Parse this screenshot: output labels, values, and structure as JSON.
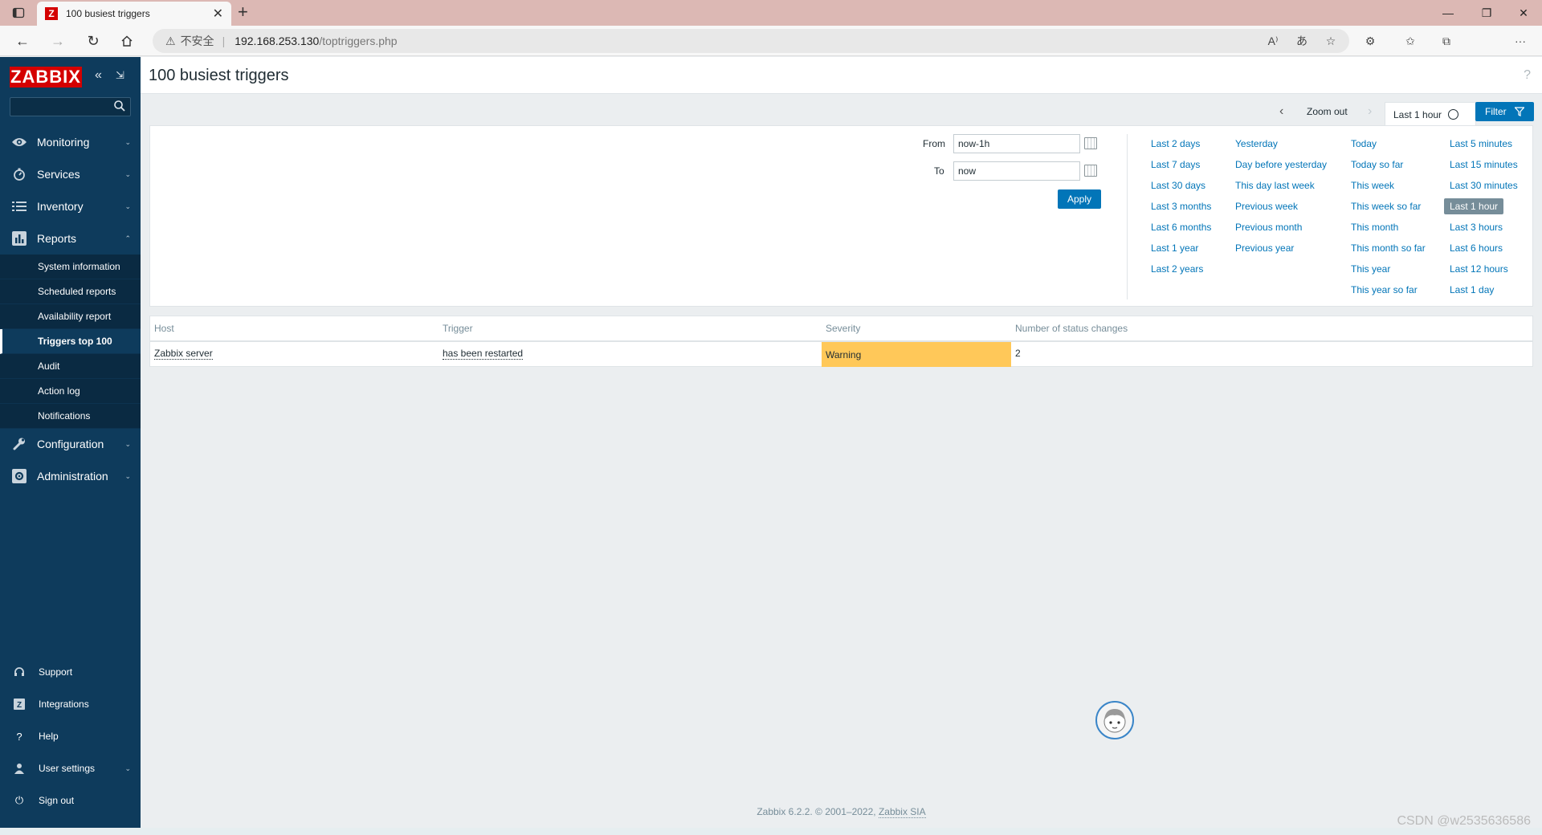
{
  "browser": {
    "tab_title": "100 busiest triggers",
    "favicon_letter": "Z",
    "url_security": "不安全",
    "url_host": "192.168.253.130",
    "url_path": "/toptriggers.php"
  },
  "sidebar": {
    "logo": "ZABBIX",
    "menu": [
      {
        "label": "Monitoring",
        "icon": "eye-icon"
      },
      {
        "label": "Services",
        "icon": "services-icon"
      },
      {
        "label": "Inventory",
        "icon": "list-icon"
      },
      {
        "label": "Reports",
        "icon": "reports-icon"
      },
      {
        "label": "Configuration",
        "icon": "wrench-icon"
      },
      {
        "label": "Administration",
        "icon": "gear-icon"
      }
    ],
    "reports_sub": [
      "System information",
      "Scheduled reports",
      "Availability report",
      "Triggers top 100",
      "Audit",
      "Action log",
      "Notifications"
    ],
    "bottom": [
      {
        "label": "Support",
        "icon": "headset-icon"
      },
      {
        "label": "Integrations",
        "icon": "integrations-icon"
      },
      {
        "label": "Help",
        "icon": "question-icon"
      },
      {
        "label": "User settings",
        "icon": "user-icon"
      },
      {
        "label": "Sign out",
        "icon": "power-icon"
      }
    ]
  },
  "page": {
    "title": "100 busiest triggers",
    "help_glyph": "?"
  },
  "timebar": {
    "zoom_out": "Zoom out",
    "period": "Last 1 hour",
    "filter": "Filter"
  },
  "filter": {
    "from_label": "From",
    "from_value": "now-1h",
    "to_label": "To",
    "to_value": "now",
    "apply": "Apply",
    "quick_ranges": [
      [
        "Last 2 days",
        "Last 7 days",
        "Last 30 days",
        "Last 3 months",
        "Last 6 months",
        "Last 1 year",
        "Last 2 years"
      ],
      [
        "Yesterday",
        "Day before yesterday",
        "This day last week",
        "Previous week",
        "Previous month",
        "Previous year"
      ],
      [
        "Today",
        "Today so far",
        "This week",
        "This week so far",
        "This month",
        "This month so far",
        "This year",
        "This year so far"
      ],
      [
        "Last 5 minutes",
        "Last 15 minutes",
        "Last 30 minutes",
        "Last 1 hour",
        "Last 3 hours",
        "Last 6 hours",
        "Last 12 hours",
        "Last 1 day"
      ]
    ],
    "selected_range": "Last 1 hour"
  },
  "table": {
    "columns": [
      "Host",
      "Trigger",
      "Severity",
      "Number of status changes"
    ],
    "rows": [
      {
        "host": "Zabbix server",
        "trigger": "has been restarted",
        "severity": "Warning",
        "changes": "2"
      }
    ],
    "severity_color": "#ffc859"
  },
  "footer": {
    "text": "Zabbix 6.2.2. © 2001–2022, ",
    "company": "Zabbix SIA"
  },
  "watermark": "CSDN @w2535636586",
  "colors": {
    "sidebar": "#0e3b5c",
    "accent": "#0275b8",
    "logo": "#d40000"
  }
}
